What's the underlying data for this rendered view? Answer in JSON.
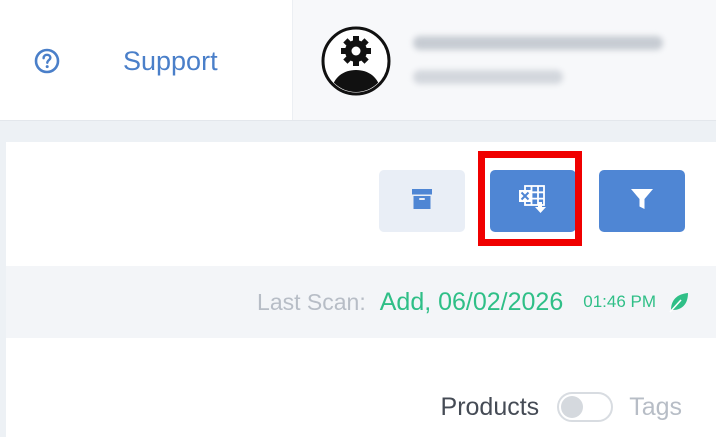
{
  "header": {
    "support_label": "Support",
    "help_icon": "question-circle-icon",
    "user": {
      "avatar_icon": "user-gear-avatar-icon"
    }
  },
  "toolbar": {
    "buttons": [
      {
        "icon": "archive-icon",
        "variant": "light"
      },
      {
        "icon": "excel-export-icon",
        "variant": "primary",
        "highlighted": true
      },
      {
        "icon": "filter-icon",
        "variant": "primary"
      }
    ]
  },
  "scan": {
    "label": "Last Scan:",
    "date": "Add, 06/02/2026",
    "time": "01:46 PM",
    "status_icon": "leaf-icon"
  },
  "view_toggle": {
    "left_label": "Products",
    "right_label": "Tags",
    "state": "off"
  },
  "colors": {
    "primary": "#4f86d4",
    "link": "#4a7fc9",
    "success": "#2fbf87",
    "highlight": "#f00000",
    "muted": "#b7bdc6"
  }
}
